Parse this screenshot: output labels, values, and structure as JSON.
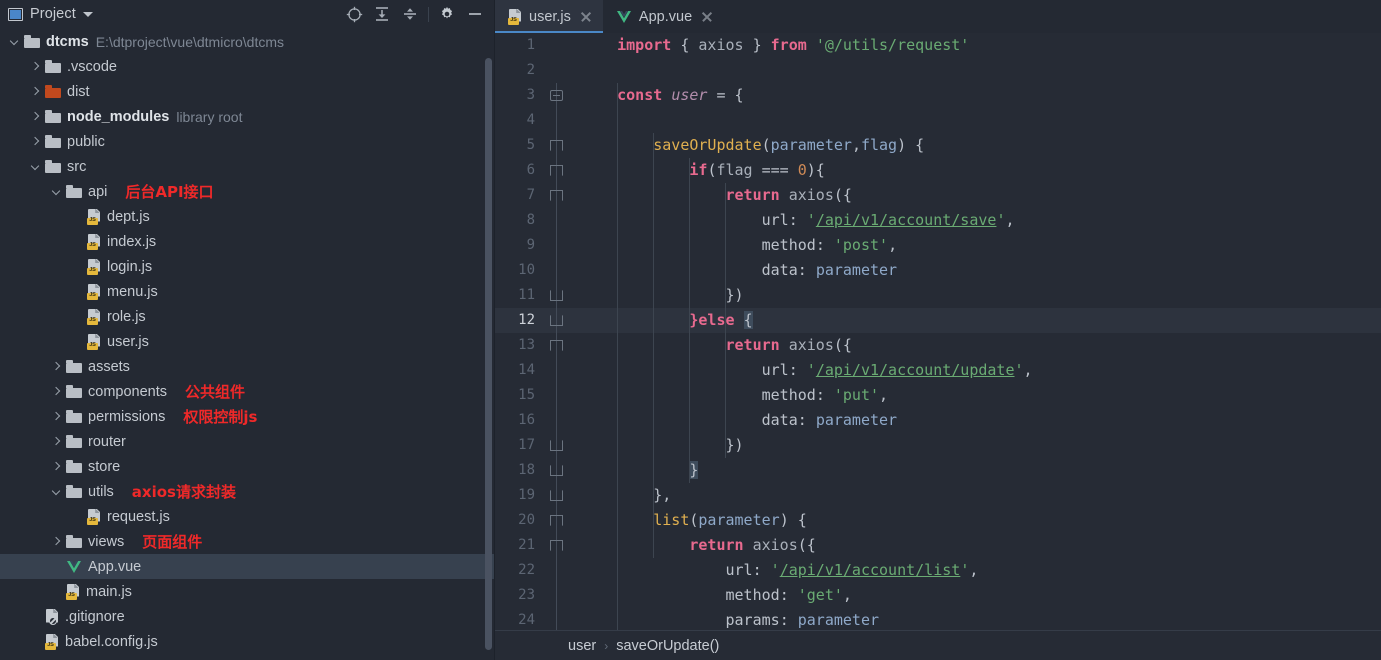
{
  "panel": {
    "title": "Project",
    "icon": "project-icon",
    "dropdown_icon": "chevron-down-icon",
    "toolbar": [
      {
        "name": "locate-icon",
        "label": "Select Opened File"
      },
      {
        "name": "expand-all-icon",
        "label": "Expand All"
      },
      {
        "name": "collapse-all-icon",
        "label": "Collapse All"
      },
      {
        "name": "gear-icon",
        "label": "Settings"
      },
      {
        "name": "minimize-icon",
        "label": "Hide"
      }
    ]
  },
  "tree": [
    {
      "depth": 0,
      "arrow": "open",
      "icon": "folder",
      "label": "dtcms",
      "bold": true,
      "sub": "E:\\dtproject\\vue\\dtmicro\\dtcms",
      "note": "",
      "selected": false
    },
    {
      "depth": 1,
      "arrow": "closed",
      "icon": "folder",
      "label": ".vscode",
      "bold": false,
      "sub": "",
      "note": "",
      "selected": false
    },
    {
      "depth": 1,
      "arrow": "closed",
      "icon": "folder-orange",
      "label": "dist",
      "bold": false,
      "sub": "",
      "note": "",
      "selected": false
    },
    {
      "depth": 1,
      "arrow": "closed",
      "icon": "folder",
      "label": "node_modules",
      "bold": true,
      "sub": "library root",
      "note": "",
      "selected": false
    },
    {
      "depth": 1,
      "arrow": "closed",
      "icon": "folder",
      "label": "public",
      "bold": false,
      "sub": "",
      "note": "",
      "selected": false
    },
    {
      "depth": 1,
      "arrow": "open",
      "icon": "folder",
      "label": "src",
      "bold": false,
      "sub": "",
      "note": "",
      "selected": false
    },
    {
      "depth": 2,
      "arrow": "open",
      "icon": "folder",
      "label": "api",
      "bold": false,
      "sub": "",
      "note": "后台API接口",
      "selected": false
    },
    {
      "depth": 3,
      "arrow": "none",
      "icon": "js",
      "label": "dept.js",
      "bold": false,
      "sub": "",
      "note": "",
      "selected": false
    },
    {
      "depth": 3,
      "arrow": "none",
      "icon": "js",
      "label": "index.js",
      "bold": false,
      "sub": "",
      "note": "",
      "selected": false
    },
    {
      "depth": 3,
      "arrow": "none",
      "icon": "js",
      "label": "login.js",
      "bold": false,
      "sub": "",
      "note": "",
      "selected": false
    },
    {
      "depth": 3,
      "arrow": "none",
      "icon": "js",
      "label": "menu.js",
      "bold": false,
      "sub": "",
      "note": "",
      "selected": false
    },
    {
      "depth": 3,
      "arrow": "none",
      "icon": "js",
      "label": "role.js",
      "bold": false,
      "sub": "",
      "note": "",
      "selected": false
    },
    {
      "depth": 3,
      "arrow": "none",
      "icon": "js",
      "label": "user.js",
      "bold": false,
      "sub": "",
      "note": "",
      "selected": false
    },
    {
      "depth": 2,
      "arrow": "closed",
      "icon": "folder",
      "label": "assets",
      "bold": false,
      "sub": "",
      "note": "",
      "selected": false
    },
    {
      "depth": 2,
      "arrow": "closed",
      "icon": "folder",
      "label": "components",
      "bold": false,
      "sub": "",
      "note": "公共组件",
      "selected": false
    },
    {
      "depth": 2,
      "arrow": "closed",
      "icon": "folder",
      "label": "permissions",
      "bold": false,
      "sub": "",
      "note": "权限控制js",
      "selected": false
    },
    {
      "depth": 2,
      "arrow": "closed",
      "icon": "folder",
      "label": "router",
      "bold": false,
      "sub": "",
      "note": "",
      "selected": false
    },
    {
      "depth": 2,
      "arrow": "closed",
      "icon": "folder",
      "label": "store",
      "bold": false,
      "sub": "",
      "note": "",
      "selected": false
    },
    {
      "depth": 2,
      "arrow": "open",
      "icon": "folder",
      "label": "utils",
      "bold": false,
      "sub": "",
      "note": "axios请求封装",
      "selected": false
    },
    {
      "depth": 3,
      "arrow": "none",
      "icon": "js",
      "label": "request.js",
      "bold": false,
      "sub": "",
      "note": "",
      "selected": false
    },
    {
      "depth": 2,
      "arrow": "closed",
      "icon": "folder",
      "label": "views",
      "bold": false,
      "sub": "",
      "note": "页面组件",
      "selected": false
    },
    {
      "depth": 2,
      "arrow": "none",
      "icon": "vue",
      "label": "App.vue",
      "bold": false,
      "sub": "",
      "note": "",
      "selected": true
    },
    {
      "depth": 2,
      "arrow": "none",
      "icon": "js",
      "label": "main.js",
      "bold": false,
      "sub": "",
      "note": "",
      "selected": false
    },
    {
      "depth": 1,
      "arrow": "none",
      "icon": "gitignore",
      "label": ".gitignore",
      "bold": false,
      "sub": "",
      "note": "",
      "selected": false
    },
    {
      "depth": 1,
      "arrow": "none",
      "icon": "js",
      "label": "babel.config.js",
      "bold": false,
      "sub": "",
      "note": "",
      "selected": false
    }
  ],
  "editor": {
    "tabs": [
      {
        "label": "user.js",
        "icon": "js-file-icon",
        "active": true,
        "close_icon": "close-icon"
      },
      {
        "label": "App.vue",
        "icon": "vue-file-icon",
        "active": false,
        "close_icon": "close-icon"
      }
    ],
    "current_line": 12,
    "breadcrumb": [
      "user",
      "saveOrUpdate()"
    ],
    "lines": [
      {
        "n": 1,
        "fold": "none",
        "indent": 1,
        "tokens": [
          {
            "t": "import",
            "c": "kw"
          },
          {
            "t": " { ",
            "c": "plain"
          },
          {
            "t": "axios",
            "c": "dim"
          },
          {
            "t": " } ",
            "c": "plain"
          },
          {
            "t": "from",
            "c": "kw"
          },
          {
            "t": " ",
            "c": "plain"
          },
          {
            "t": "'@/utils/request'",
            "c": "str"
          }
        ]
      },
      {
        "n": 2,
        "fold": "none",
        "indent": 1,
        "tokens": []
      },
      {
        "n": 3,
        "fold": "minus",
        "indent": 1,
        "tokens": [
          {
            "t": "const",
            "c": "kw"
          },
          {
            "t": " ",
            "c": "plain"
          },
          {
            "t": "user",
            "c": "ital"
          },
          {
            "t": " = {",
            "c": "plain"
          }
        ]
      },
      {
        "n": 4,
        "fold": "none",
        "indent": 1,
        "tokens": []
      },
      {
        "n": 5,
        "fold": "chev",
        "indent": 2,
        "tokens": [
          {
            "t": "saveOrUpdate",
            "c": "fn"
          },
          {
            "t": "(",
            "c": "plain"
          },
          {
            "t": "parameter",
            "c": "param"
          },
          {
            "t": ",",
            "c": "plain"
          },
          {
            "t": "flag",
            "c": "param"
          },
          {
            "t": ") {",
            "c": "plain"
          }
        ]
      },
      {
        "n": 6,
        "fold": "chev",
        "indent": 3,
        "tokens": [
          {
            "t": "if",
            "c": "kw"
          },
          {
            "t": "(",
            "c": "plain"
          },
          {
            "t": "flag",
            "c": "dim"
          },
          {
            "t": " === ",
            "c": "plain"
          },
          {
            "t": "0",
            "c": "num"
          },
          {
            "t": "){",
            "c": "plain"
          }
        ]
      },
      {
        "n": 7,
        "fold": "chev",
        "indent": 4,
        "tokens": [
          {
            "t": "return",
            "c": "kw"
          },
          {
            "t": " ",
            "c": "plain"
          },
          {
            "t": "axios",
            "c": "dim"
          },
          {
            "t": "({",
            "c": "plain"
          }
        ]
      },
      {
        "n": 8,
        "fold": "none",
        "indent": 5,
        "tokens": [
          {
            "t": "url",
            "c": "plain"
          },
          {
            "t": ": ",
            "c": "plain"
          },
          {
            "t": "'",
            "c": "str"
          },
          {
            "t": "/api/v1/account/save",
            "c": "strlink"
          },
          {
            "t": "'",
            "c": "str"
          },
          {
            "t": ",",
            "c": "plain"
          }
        ]
      },
      {
        "n": 9,
        "fold": "none",
        "indent": 5,
        "tokens": [
          {
            "t": "method",
            "c": "plain"
          },
          {
            "t": ": ",
            "c": "plain"
          },
          {
            "t": "'post'",
            "c": "str"
          },
          {
            "t": ",",
            "c": "plain"
          }
        ]
      },
      {
        "n": 10,
        "fold": "none",
        "indent": 5,
        "tokens": [
          {
            "t": "data",
            "c": "plain"
          },
          {
            "t": ": ",
            "c": "plain"
          },
          {
            "t": "parameter",
            "c": "param"
          }
        ]
      },
      {
        "n": 11,
        "fold": "chevup",
        "indent": 4,
        "tokens": [
          {
            "t": "})",
            "c": "plain"
          }
        ]
      },
      {
        "n": 12,
        "fold": "chevup",
        "indent": 3,
        "tokens": [
          {
            "t": "}",
            "c": "kw"
          },
          {
            "t": "else",
            "c": "kw"
          },
          {
            "t": " ",
            "c": "plain"
          },
          {
            "t": "{",
            "c": "brace"
          }
        ]
      },
      {
        "n": 13,
        "fold": "chev",
        "indent": 4,
        "tokens": [
          {
            "t": "return",
            "c": "kw"
          },
          {
            "t": " ",
            "c": "plain"
          },
          {
            "t": "axios",
            "c": "dim"
          },
          {
            "t": "({",
            "c": "plain"
          }
        ]
      },
      {
        "n": 14,
        "fold": "none",
        "indent": 5,
        "tokens": [
          {
            "t": "url",
            "c": "plain"
          },
          {
            "t": ": ",
            "c": "plain"
          },
          {
            "t": "'",
            "c": "str"
          },
          {
            "t": "/api/v1/account/update",
            "c": "strlink"
          },
          {
            "t": "'",
            "c": "str"
          },
          {
            "t": ",",
            "c": "plain"
          }
        ]
      },
      {
        "n": 15,
        "fold": "none",
        "indent": 5,
        "tokens": [
          {
            "t": "method",
            "c": "plain"
          },
          {
            "t": ": ",
            "c": "plain"
          },
          {
            "t": "'put'",
            "c": "str"
          },
          {
            "t": ",",
            "c": "plain"
          }
        ]
      },
      {
        "n": 16,
        "fold": "none",
        "indent": 5,
        "tokens": [
          {
            "t": "data",
            "c": "plain"
          },
          {
            "t": ": ",
            "c": "plain"
          },
          {
            "t": "parameter",
            "c": "param"
          }
        ]
      },
      {
        "n": 17,
        "fold": "chevup",
        "indent": 4,
        "tokens": [
          {
            "t": "})",
            "c": "plain"
          }
        ]
      },
      {
        "n": 18,
        "fold": "chevup",
        "indent": 3,
        "tokens": [
          {
            "t": "}",
            "c": "brace"
          }
        ]
      },
      {
        "n": 19,
        "fold": "chevup",
        "indent": 2,
        "tokens": [
          {
            "t": "},",
            "c": "plain"
          }
        ]
      },
      {
        "n": 20,
        "fold": "chev",
        "indent": 2,
        "tokens": [
          {
            "t": "list",
            "c": "fn"
          },
          {
            "t": "(",
            "c": "plain"
          },
          {
            "t": "parameter",
            "c": "param"
          },
          {
            "t": ") {",
            "c": "plain"
          }
        ]
      },
      {
        "n": 21,
        "fold": "chev",
        "indent": 3,
        "tokens": [
          {
            "t": "return",
            "c": "kw"
          },
          {
            "t": " ",
            "c": "plain"
          },
          {
            "t": "axios",
            "c": "dim"
          },
          {
            "t": "({",
            "c": "plain"
          }
        ]
      },
      {
        "n": 22,
        "fold": "none",
        "indent": 4,
        "tokens": [
          {
            "t": "url",
            "c": "plain"
          },
          {
            "t": ": ",
            "c": "plain"
          },
          {
            "t": "'",
            "c": "str"
          },
          {
            "t": "/api/v1/account/list",
            "c": "strlink"
          },
          {
            "t": "'",
            "c": "str"
          },
          {
            "t": ",",
            "c": "plain"
          }
        ]
      },
      {
        "n": 23,
        "fold": "none",
        "indent": 4,
        "tokens": [
          {
            "t": "method",
            "c": "plain"
          },
          {
            "t": ": ",
            "c": "plain"
          },
          {
            "t": "'get'",
            "c": "str"
          },
          {
            "t": ",",
            "c": "plain"
          }
        ]
      },
      {
        "n": 24,
        "fold": "none",
        "indent": 4,
        "tokens": [
          {
            "t": "params",
            "c": "plain"
          },
          {
            "t": ": ",
            "c": "plain"
          },
          {
            "t": "parameter",
            "c": "param"
          }
        ]
      }
    ]
  },
  "colors": {
    "panel_bg": "#242933",
    "editor_bg": "#262b35",
    "selection": "#37414f",
    "accent": "#4a88c7",
    "annotation": "#ef2929",
    "keyword": "#e86a8f",
    "string": "#6aab73",
    "function": "#e0b050",
    "parameter": "#8fa9c9",
    "number": "#cf8a56"
  }
}
